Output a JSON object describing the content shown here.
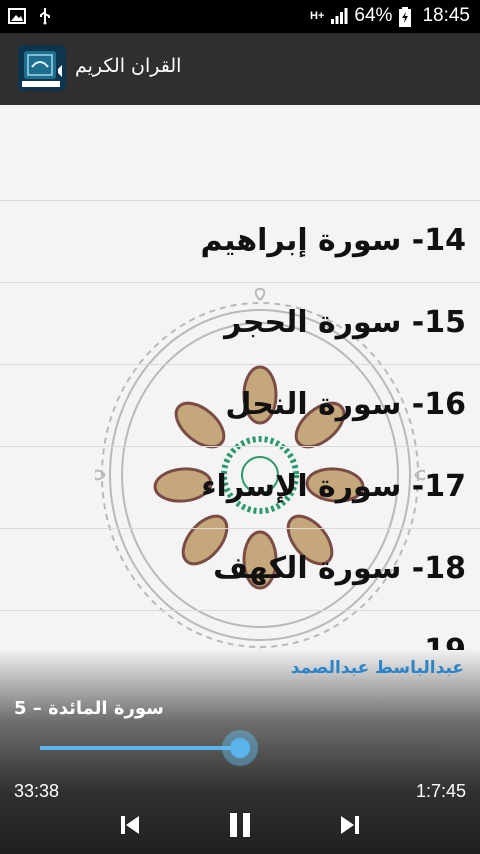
{
  "status_bar": {
    "network": "H+",
    "battery": "64%",
    "time": "18:45",
    "icons": [
      "gallery-icon",
      "usb-icon",
      "signal-icon",
      "battery-icon"
    ]
  },
  "app_bar": {
    "title": "القران الكريم"
  },
  "surahs": [
    {
      "label": "14- سورة إبراهيم"
    },
    {
      "label": "15- سورة الحجر"
    },
    {
      "label": "16- سورة النحل"
    },
    {
      "label": "17- سورة الإسراء"
    },
    {
      "label": "18- سورة الكهف"
    },
    {
      "label": "19"
    }
  ],
  "player": {
    "reciter": "عبدالباسط عبدالصمد",
    "track": "5 – سورة المائدة",
    "elapsed": "33:38",
    "duration": "1:7:45",
    "progress_fraction": 0.5,
    "accent_color": "#5ab4ea",
    "controls": [
      "previous-icon",
      "pause-icon",
      "next-icon"
    ]
  }
}
